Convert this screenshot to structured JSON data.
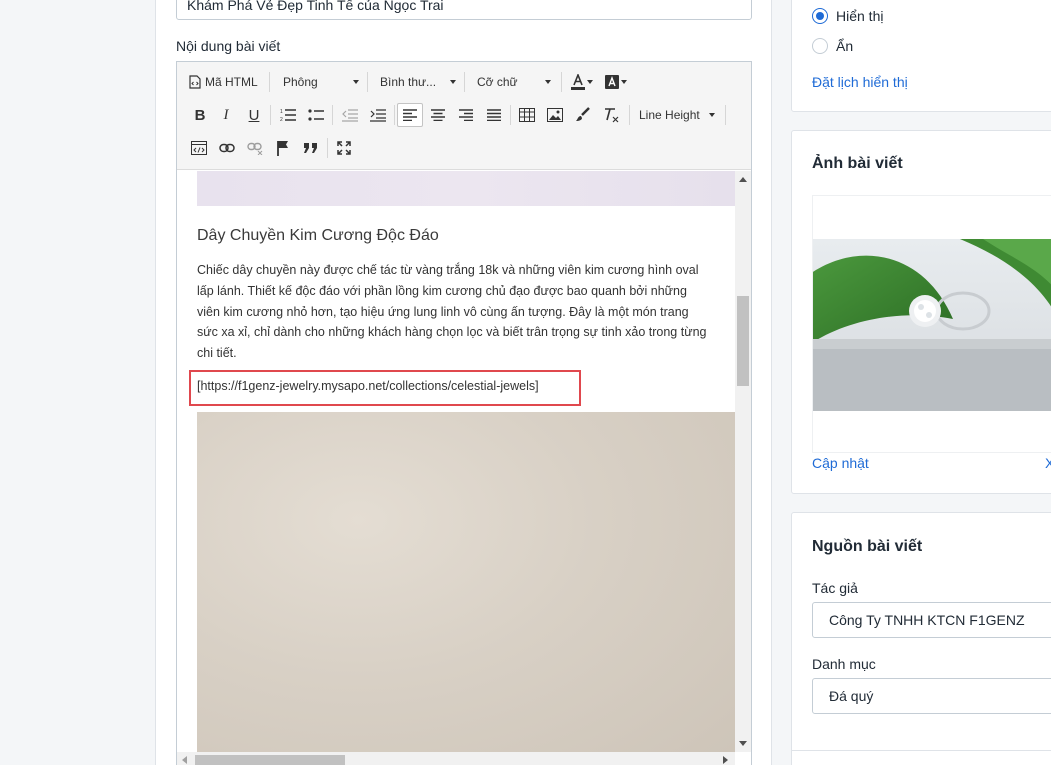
{
  "post": {
    "title_value": "Khám Phá Vẻ Đẹp Tinh Tế của Ngọc Trai",
    "content_label": "Nội dung bài viết"
  },
  "toolbar": {
    "html_label": "Mã HTML",
    "font_label": "Phông",
    "style_label": "Bình thư...",
    "size_label": "Cỡ chữ",
    "line_height_label": "Line Height"
  },
  "content": {
    "heading": "Dây Chuyền Kim Cương Độc Đáo",
    "paragraph": "Chiếc dây chuyền này được chế tác từ vàng trắng 18k và những viên kim cương hình oval lấp lánh. Thiết kế độc đáo với phần lồng kim cương chủ đạo được bao quanh bởi những viên kim cương nhỏ hơn, tạo hiệu ứng lung linh vô cùng ấn tượng. Đây là một món trang sức xa xỉ, chỉ dành cho những khách hàng chọn lọc và biết trân trọng sự tinh xảo trong từng chi tiết.",
    "link_text": "[https://f1genz-jewelry.mysapo.net/collections/celestial-jewels]"
  },
  "visibility": {
    "show_label": "Hiển thị",
    "hide_label": "Ẩn",
    "selected": "show",
    "schedule_link": "Đặt lịch hiển thị"
  },
  "image_card": {
    "title": "Ảnh bài viết",
    "update_link": "Cập nhật",
    "remove_link": "X"
  },
  "source_card": {
    "title": "Nguồn bài viết",
    "author_label": "Tác giả",
    "author_value": "Công Ty TNHH KTCN F1GENZ",
    "category_label": "Danh mục",
    "category_value": "Đá quý"
  },
  "colors": {
    "accent": "#1f6bd6",
    "highlight_border": "#e0484e"
  }
}
